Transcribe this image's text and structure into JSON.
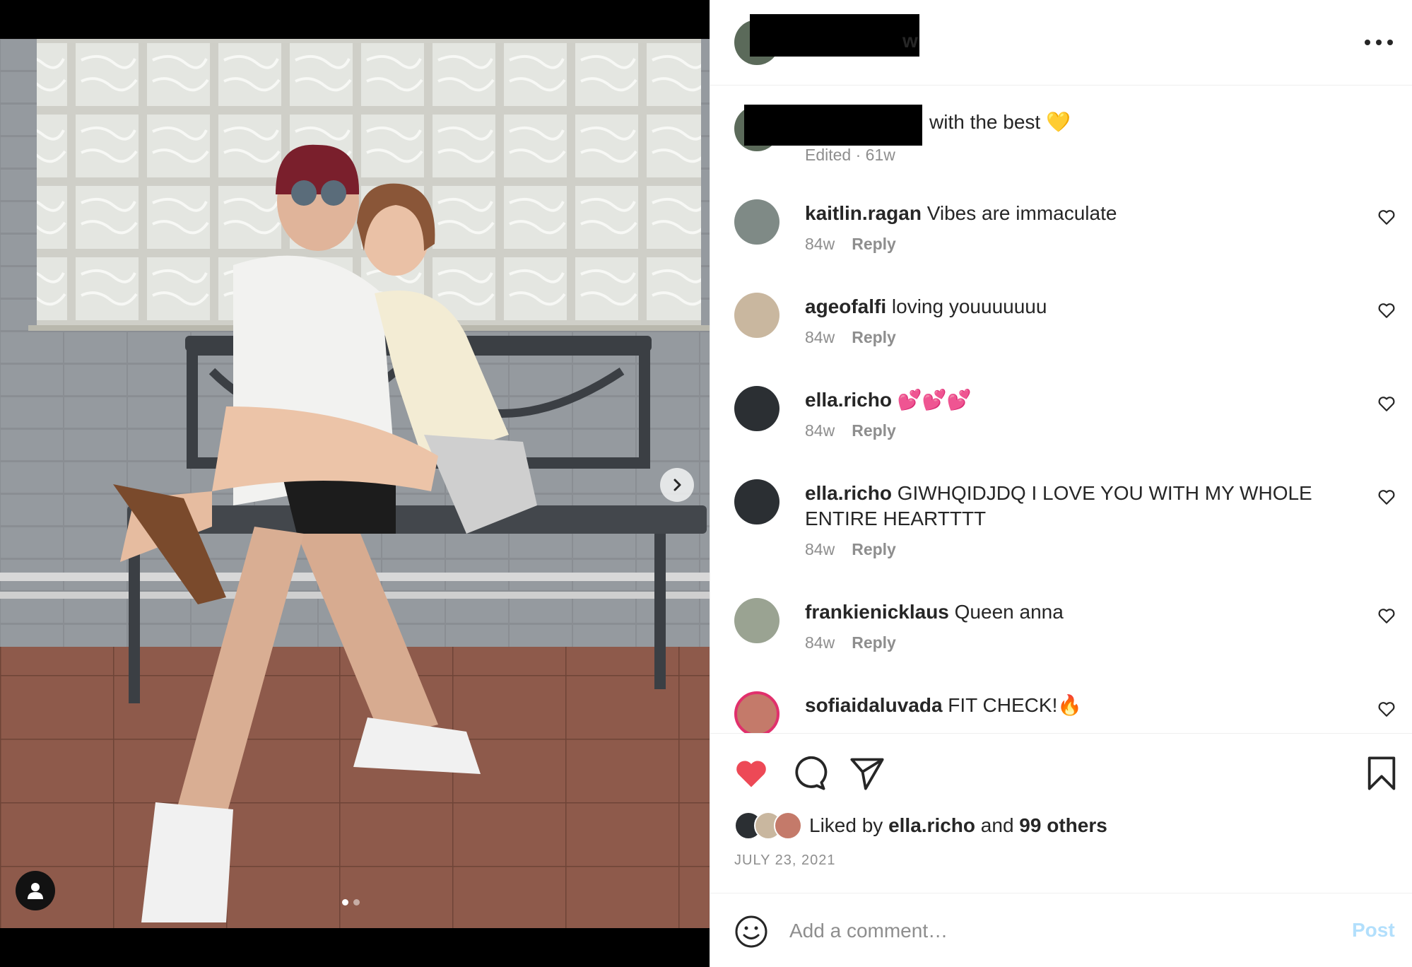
{
  "header": {
    "username_visible_suffix": "w",
    "more_icon": "more-horizontal-icon"
  },
  "caption": {
    "text": "with the best 💛",
    "meta": "Edited · 61w"
  },
  "comments": [
    {
      "user": "kaitlin.ragan",
      "text": "Vibes are immaculate",
      "age": "84w",
      "reply": "Reply"
    },
    {
      "user": "ageofalfi",
      "text": "loving youuuuuuu",
      "age": "84w",
      "reply": "Reply"
    },
    {
      "user": "ella.richo",
      "text": "💕💕💕",
      "age": "84w",
      "reply": "Reply"
    },
    {
      "user": "ella.richo",
      "text": "GIWHQIDJDQ I LOVE YOU WITH MY WHOLE ENTIRE HEARTTTT",
      "age": "84w",
      "reply": "Reply"
    },
    {
      "user": "frankienicklaus",
      "text": "Queen anna",
      "age": "84w",
      "reply": "Reply"
    },
    {
      "user": "sofiaidaluvada",
      "text": "FIT CHECK!🔥",
      "age": "",
      "reply": ""
    }
  ],
  "actions": {
    "like_icon": "heart-filled-icon",
    "comment_icon": "comment-icon",
    "share_icon": "send-icon",
    "save_icon": "bookmark-icon",
    "liked_by_prefix": "Liked by",
    "liked_by_user": "ella.richo",
    "liked_by_and": "and",
    "liked_by_others": "99 others",
    "date": "JULY 23, 2021"
  },
  "add_comment": {
    "placeholder": "Add a comment…",
    "post_label": "Post"
  },
  "colors": {
    "like_red": "#ed4956",
    "muted_text": "#8e8e8e",
    "post_disabled": "#b2dffc"
  }
}
